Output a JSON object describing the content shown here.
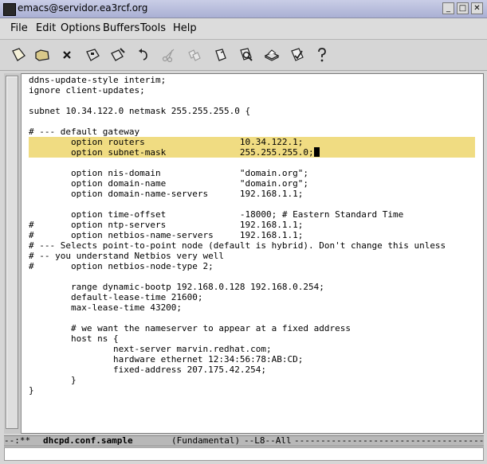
{
  "window": {
    "title": "emacs@servidor.ea3rcf.org",
    "controls": {
      "minimize": "_",
      "maximize": "□",
      "close": "✕"
    }
  },
  "menubar": {
    "items": [
      "File",
      "Edit",
      "Options",
      "Buffers",
      "Tools",
      "Help"
    ]
  },
  "toolbar": {
    "buttons": [
      {
        "icon": "new-file-icon"
      },
      {
        "icon": "open-folder-icon"
      },
      {
        "icon": "close-x-icon"
      },
      {
        "icon": "save-disk-icon"
      },
      {
        "icon": "save-as-icon"
      },
      {
        "icon": "undo-icon"
      },
      {
        "icon": "cut-scissors-icon"
      },
      {
        "icon": "copy-icon"
      },
      {
        "icon": "paste-icon"
      },
      {
        "icon": "search-icon"
      },
      {
        "icon": "print-icon"
      },
      {
        "icon": "preferences-icon"
      },
      {
        "icon": "help-icon"
      }
    ]
  },
  "editor": {
    "highlight_color": "#f0dc82",
    "lines": [
      "ddns-update-style interim;",
      "ignore client-updates;",
      "",
      "subnet 10.34.122.0 netmask 255.255.255.0 {",
      "",
      "# --- default gateway",
      "        option routers                  10.34.122.1;",
      "        option subnet-mask              255.255.255.0;",
      "",
      "        option nis-domain               \"domain.org\";",
      "        option domain-name              \"domain.org\";",
      "        option domain-name-servers      192.168.1.1;",
      "",
      "        option time-offset              -18000; # Eastern Standard Time",
      "#       option ntp-servers              192.168.1.1;",
      "#       option netbios-name-servers     192.168.1.1;",
      "# --- Selects point-to-point node (default is hybrid). Don't change this unless",
      "# -- you understand Netbios very well",
      "#       option netbios-node-type 2;",
      "",
      "        range dynamic-bootp 192.168.0.128 192.168.0.254;",
      "        default-lease-time 21600;",
      "        max-lease-time 43200;",
      "",
      "        # we want the nameserver to appear at a fixed address",
      "        host ns {",
      "                next-server marvin.redhat.com;",
      "                hardware ethernet 12:34:56:78:AB:CD;",
      "                fixed-address 207.175.42.254;",
      "        }",
      "}"
    ],
    "highlighted_lines": [
      6,
      7
    ],
    "cursor_line": 7
  },
  "modeline": {
    "prefix": "--:**  ",
    "buffer_name": "dhcpd.conf.sample",
    "mode": "(Fundamental)",
    "position": "--L8--All",
    "fill": "------------------------------------------"
  },
  "minibuffer": {
    "text": ""
  }
}
